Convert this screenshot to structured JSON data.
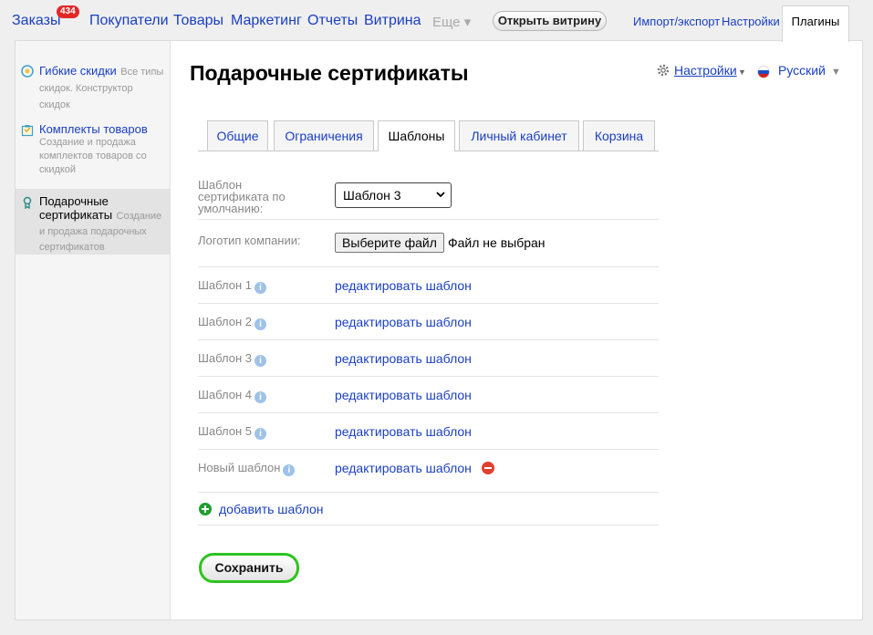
{
  "nav": {
    "items": [
      "Заказы",
      "Покупатели",
      "Товары",
      "Маркетинг",
      "Отчеты",
      "Витрина"
    ],
    "orders_badge": "434",
    "more_label": "Еще ▾",
    "open_store_label": "Открыть витрину",
    "right_items": [
      "Импорт/экспорт",
      "Настройки"
    ],
    "active_tab": "Плагины"
  },
  "sidebar": {
    "items": [
      {
        "title": "Гибкие скидки",
        "desc": "Все типы скидок. Конструктор скидок",
        "icon": "discount-icon"
      },
      {
        "title": "Комплекты товаров",
        "desc": "Создание и продажа комплектов товаров со скидкой",
        "icon": "bundle-icon"
      },
      {
        "title": "Подарочные сертификаты",
        "desc": "Создание и продажа подарочных сертификатов",
        "icon": "certificate-icon"
      }
    ]
  },
  "page": {
    "title": "Подарочные сертификаты",
    "settings_label": "Настройки",
    "language_label": "Русский"
  },
  "tabs": [
    "Общие",
    "Ограничения",
    "Шаблоны",
    "Личный кабинет",
    "Корзина"
  ],
  "active_tab": "Шаблоны",
  "form": {
    "default_template_label": "Шаблон сертификата по умолчанию:",
    "default_template_value": "Шаблон 3",
    "logo_label": "Логотип компании:",
    "file_button_label": "Выберите файл",
    "file_status": "Файл не выбран",
    "templates": [
      {
        "label": "Шаблон 1",
        "link": "редактировать шаблон"
      },
      {
        "label": "Шаблон 2",
        "link": "редактировать шаблон"
      },
      {
        "label": "Шаблон 3",
        "link": "редактировать шаблон"
      },
      {
        "label": "Шаблон 4",
        "link": "редактировать шаблон"
      },
      {
        "label": "Шаблон 5",
        "link": "редактировать шаблон"
      },
      {
        "label": "Новый шаблон",
        "link": "редактировать шаблон"
      }
    ],
    "add_template_label": "добавить шаблон",
    "save_label": "Сохранить"
  },
  "colors": {
    "link": "#1a3fbf",
    "badge": "#e32828",
    "save_border": "#2ec41f",
    "add_icon": "#1f9e2f",
    "remove_icon": "#e0412f"
  }
}
